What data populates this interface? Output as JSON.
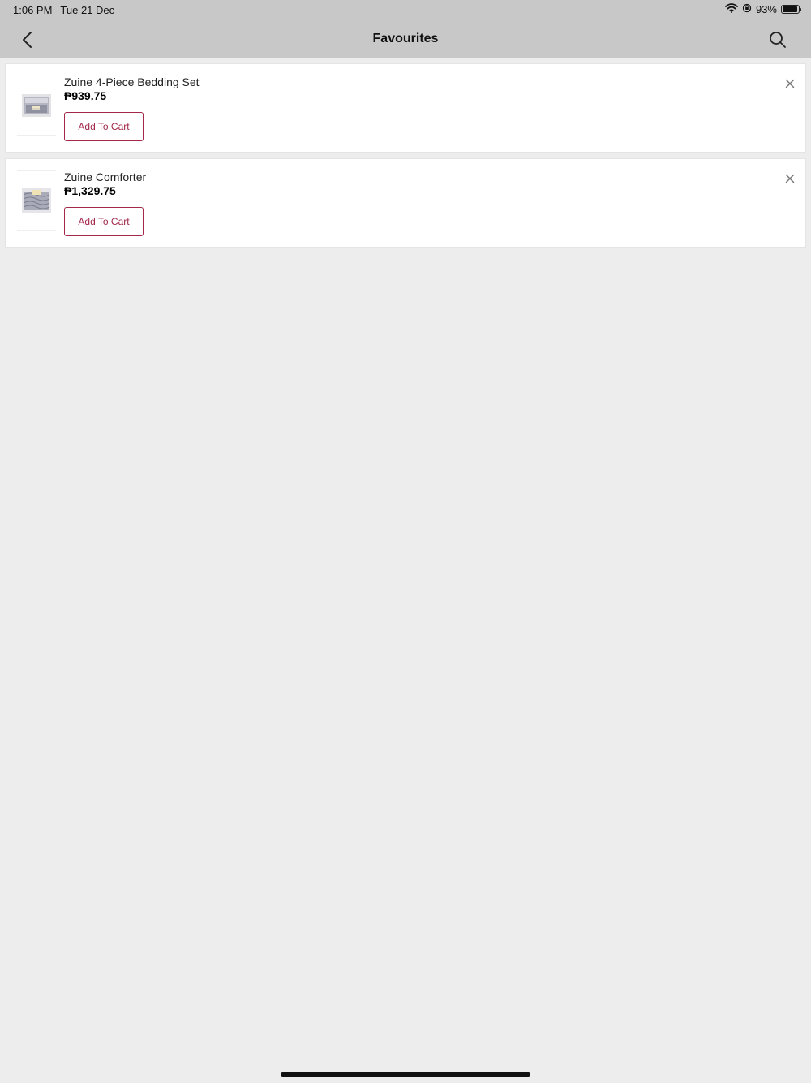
{
  "status_bar": {
    "time": "1:06 PM",
    "date": "Tue 21 Dec",
    "battery_text": "93%",
    "battery_level": 0.93
  },
  "nav": {
    "title": "Favourites",
    "back_icon": "chevron-left-icon",
    "search_icon": "search-icon"
  },
  "items": [
    {
      "name": "Zuine 4-Piece Bedding Set",
      "price": "₱939.75",
      "button_label": "Add To Cart"
    },
    {
      "name": "Zuine Comforter",
      "price": "₱1,329.75",
      "button_label": "Add To Cart"
    }
  ],
  "colors": {
    "accent": "#a3284a",
    "header_bg": "#c8c8c8",
    "page_bg": "#ededed"
  }
}
